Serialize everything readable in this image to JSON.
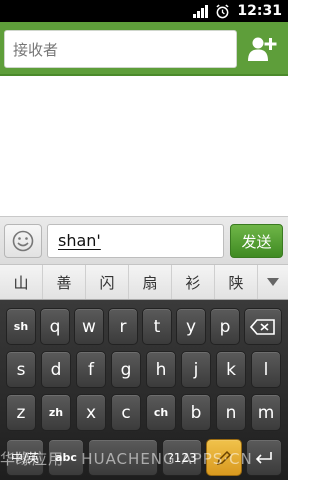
{
  "status_bar": {
    "time": "12:31",
    "icons": [
      "signal-icon",
      "alarm-icon"
    ]
  },
  "recipient": {
    "placeholder": "接收者",
    "add_icon": "add-contact-icon"
  },
  "compose": {
    "emoji_icon": "smiley-icon",
    "text": "shan'",
    "send_label": "发送"
  },
  "candidates": [
    "山",
    "善",
    "闪",
    "扇",
    "衫",
    "陕"
  ],
  "keyboard": {
    "row1": [
      "sh",
      "q",
      "w",
      "r",
      "t",
      "y",
      "p"
    ],
    "row2": [
      "s",
      "d",
      "f",
      "g",
      "h",
      "j",
      "k",
      "l"
    ],
    "row3": [
      "z",
      "zh",
      "x",
      "c",
      "ch",
      "b",
      "n",
      "m"
    ],
    "row4": [
      "中/英",
      "abc",
      "",
      "?123",
      "",
      ""
    ]
  },
  "watermark": "华缘应用 · HUACHENG·APPS·CN",
  "colors": {
    "header_green": "#5e9e3a",
    "send_green": "#4f9a2e",
    "keyboard_bg": "#2b2b2b"
  }
}
